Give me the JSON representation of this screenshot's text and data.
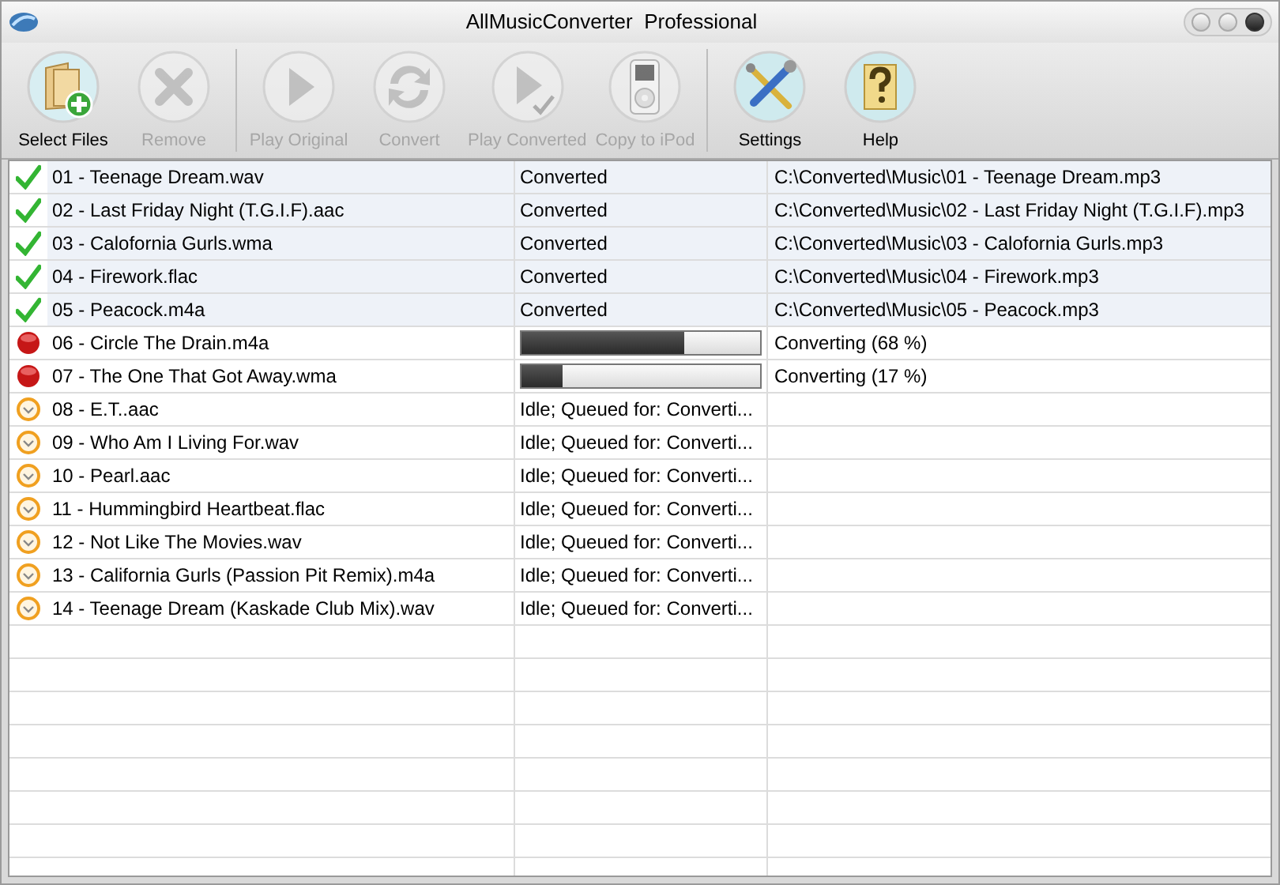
{
  "window": {
    "title": "AllMusicConverter  Professional"
  },
  "toolbar": [
    {
      "kind": "select",
      "label": "Select Files",
      "disabled": false
    },
    {
      "kind": "remove",
      "label": "Remove",
      "disabled": true
    },
    {
      "kind": "separator"
    },
    {
      "kind": "play",
      "label": "Play Original",
      "disabled": true
    },
    {
      "kind": "convert",
      "label": "Convert",
      "disabled": true
    },
    {
      "kind": "play-converted",
      "label": "Play Converted",
      "disabled": true
    },
    {
      "kind": "ipod",
      "label": "Copy to iPod",
      "disabled": true
    },
    {
      "kind": "separator"
    },
    {
      "kind": "settings",
      "label": "Settings",
      "disabled": false
    },
    {
      "kind": "help",
      "label": "Help",
      "disabled": false
    }
  ],
  "table": {
    "rows": [
      {
        "kind": "done",
        "file": "01 - Teenage Dream.wav",
        "status": "Converted",
        "output": "C:\\Converted\\Music\\01 - Teenage Dream.mp3"
      },
      {
        "kind": "done",
        "file": "02 - Last Friday Night (T.G.I.F).aac",
        "status": "Converted",
        "output": "C:\\Converted\\Music\\02 - Last Friday Night (T.G.I.F).mp3"
      },
      {
        "kind": "done",
        "file": "03 - Calofornia Gurls.wma",
        "status": "Converted",
        "output": "C:\\Converted\\Music\\03 - Calofornia Gurls.mp3"
      },
      {
        "kind": "done",
        "file": "04 - Firework.flac",
        "status": "Converted",
        "output": "C:\\Converted\\Music\\04 - Firework.mp3"
      },
      {
        "kind": "done",
        "file": "05 - Peacock.m4a",
        "status": "Converted",
        "output": "C:\\Converted\\Music\\05 - Peacock.mp3"
      },
      {
        "kind": "converting",
        "file": "06 - Circle The Drain.m4a",
        "level": 0.68,
        "output": "Converting (68 %)"
      },
      {
        "kind": "converting",
        "file": "07 - The One That Got Away.wma",
        "level": 0.17,
        "output": "Converting (17 %)"
      },
      {
        "kind": "queued",
        "file": "08 - E.T..aac",
        "status": "Idle; Queued for: Converti..."
      },
      {
        "kind": "queued",
        "file": "09 - Who Am I Living For.wav",
        "status": "Idle; Queued for: Converti..."
      },
      {
        "kind": "queued",
        "file": "10 - Pearl.aac",
        "status": "Idle; Queued for: Converti..."
      },
      {
        "kind": "queued",
        "file": "11 - Hummingbird Heartbeat.flac",
        "status": "Idle; Queued for: Converti..."
      },
      {
        "kind": "queued",
        "file": "12 - Not Like The Movies.wav",
        "status": "Idle; Queued for: Converti..."
      },
      {
        "kind": "queued",
        "file": "13 - California Gurls (Passion Pit Remix).m4a",
        "status": "Idle; Queued for: Converti..."
      },
      {
        "kind": "queued",
        "file": "14 - Teenage Dream (Kaskade Club Mix).wav",
        "status": "Idle; Queued for: Converti..."
      }
    ]
  }
}
